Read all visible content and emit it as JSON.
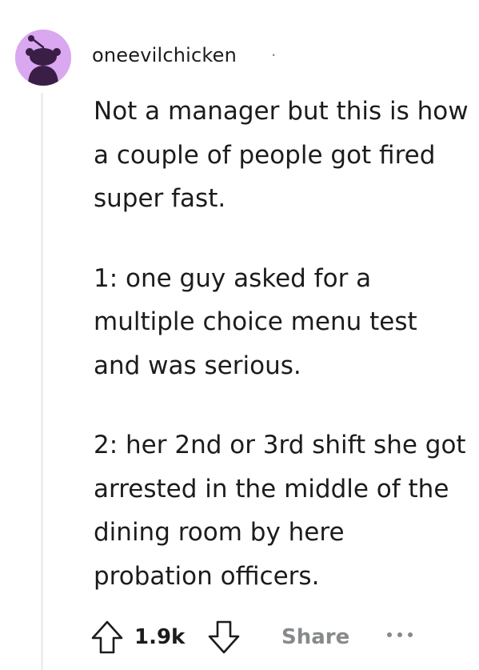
{
  "comment": {
    "author": "oneevilchicken",
    "separator": "·",
    "avatar_icon": "reddit-snoo-avatar-icon",
    "avatar_color": "#d9a8f0",
    "paragraphs": [
      "Not a manager but this is how a couple of people got fired super fast.",
      "1: one guy asked for a multiple choice menu test and was serious.",
      "2: her 2nd or 3rd shift she got arrested in the middle of the dining room by here probation officers."
    ]
  },
  "actions": {
    "upvote_icon": "upvote-arrow-icon",
    "score": "1.9k",
    "downvote_icon": "downvote-arrow-icon",
    "share_label": "Share",
    "more_icon": "more-options-icon"
  },
  "colors": {
    "text": "#1c1c1c",
    "muted": "#878a8c",
    "thread_line": "#edeff1"
  }
}
